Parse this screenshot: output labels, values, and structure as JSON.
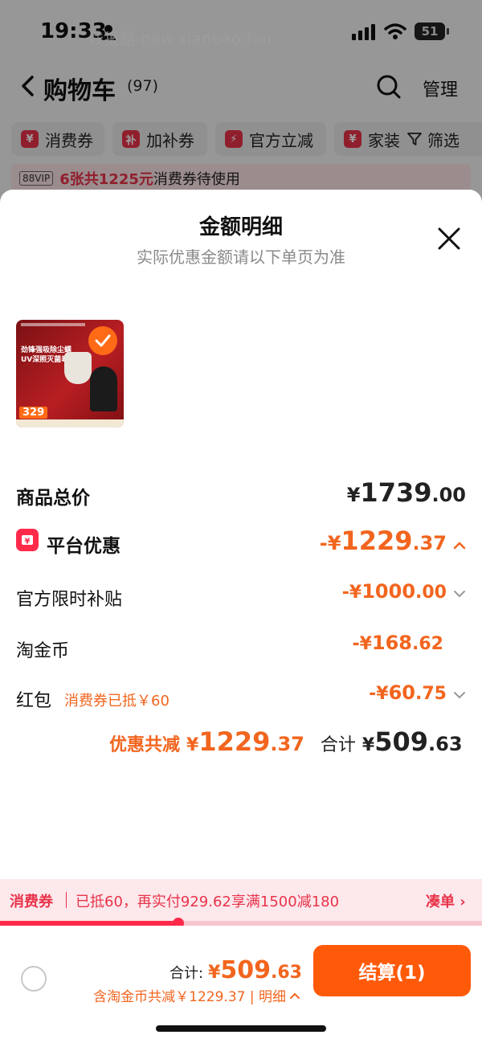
{
  "status_bar": {
    "time": "19:33",
    "battery": "51",
    "watermark": "线报酷-new.xianbao.fun"
  },
  "nav": {
    "title": "购物车",
    "count": "(97)",
    "manage": "管理"
  },
  "chips": [
    {
      "icon": "¥",
      "label": "消费券"
    },
    {
      "icon": "补",
      "label": "加补券"
    },
    {
      "icon": "⚡",
      "label": "官方立减"
    },
    {
      "icon": "¥",
      "label": "家装"
    }
  ],
  "filter": {
    "label": "筛选"
  },
  "vip_banner": {
    "tag": "88VIP",
    "highlight": "6张共1225元",
    "text": "消费券待使用"
  },
  "sheet": {
    "title": "金额明细",
    "subtitle": "实际优惠金额请以下单页为准"
  },
  "product": {
    "line1": "劲锋强吸除尘螨",
    "line2": "UV深照灭菌毒",
    "price": "329"
  },
  "rows": {
    "total": {
      "label": "商品总价",
      "currency": "¥",
      "int": "1739",
      "dec": ".00"
    },
    "platform": {
      "label": "平台优惠",
      "currency": "-¥",
      "int": "1229",
      "dec": ".37"
    },
    "subsidy": {
      "label": "官方限时补贴",
      "currency": "-¥",
      "int": "1000",
      "dec": ".00"
    },
    "coins": {
      "label": "淘金币",
      "currency": "-¥",
      "int": "168",
      "dec": ".62"
    },
    "redpack": {
      "label": "红包",
      "note": "消费券已抵￥60",
      "currency": "-¥",
      "int": "60",
      "dec": ".75"
    }
  },
  "summary": {
    "discount_label": "优惠共减",
    "discount_currency": "¥",
    "discount_int": "1229",
    "discount_dec": ".37",
    "total_label": "合计",
    "total_currency": "¥",
    "total_int": "509",
    "total_dec": ".63"
  },
  "promo": {
    "tag": "消费券",
    "text": "已抵60，再实付929.62享满1500减180",
    "link": "凑单 ›",
    "progress": 0.37
  },
  "bottom": {
    "total_label": "合计:",
    "currency": "¥",
    "int": "509",
    "dec": ".63",
    "sub_text": "含淘金币共减￥1229.37 | 明细",
    "checkout": "结算(1)"
  },
  "colors": {
    "accent": "#f2651e",
    "brand_red": "#ff2a4a",
    "checkout": "#ff5a0a"
  }
}
